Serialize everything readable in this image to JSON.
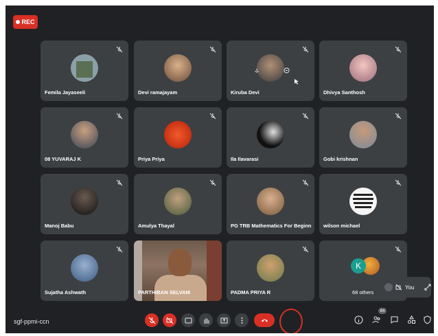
{
  "recording": {
    "label": "REC"
  },
  "participants": [
    {
      "name": "Femila Jayaseeli",
      "avatar_color": "#8ba0a8"
    },
    {
      "name": "Devi ramajayam",
      "avatar_color": "#a9745a"
    },
    {
      "name": "Kiruba Devi",
      "avatar_color": "#6b6b6b"
    },
    {
      "name": "Dhivya Santhosh",
      "avatar_color": "#c9a0a8"
    },
    {
      "name": "08 YUVARAJ K",
      "avatar_color": "#4b5563"
    },
    {
      "name": "Priya Priya",
      "avatar_color": "#e2481c"
    },
    {
      "name": "Ila Ilavarasi",
      "avatar_color": "#111111"
    },
    {
      "name": "Gobi krishnan",
      "avatar_color": "#7a8a9a"
    },
    {
      "name": "Manoj Babu",
      "avatar_color": "#1f1f1f"
    },
    {
      "name": "Amulya Thayal",
      "avatar_color": "#8a7a62"
    },
    {
      "name": "PG TRB Mathematics For Beginn...",
      "avatar_color": "#b58a60"
    },
    {
      "name": "wilson michael",
      "avatar_color": "#f5f5f5"
    },
    {
      "name": "Sujatha Ashwath",
      "avatar_color": "#5a7aa0"
    },
    {
      "name": "PARTHIBAN SELVAM",
      "avatar_color": "#8a5a3c"
    },
    {
      "name": "PADMA PRIYA R",
      "avatar_color": "#6b7a4a"
    }
  ],
  "others": {
    "count_label": "68 others",
    "initial": "K"
  },
  "self_view": {
    "label": "You"
  },
  "meeting": {
    "code": "sgf-ppmi-ccn"
  },
  "people_count": "84",
  "colors": {
    "background": "#202124",
    "tile": "#3c4043",
    "danger": "#d93025"
  }
}
